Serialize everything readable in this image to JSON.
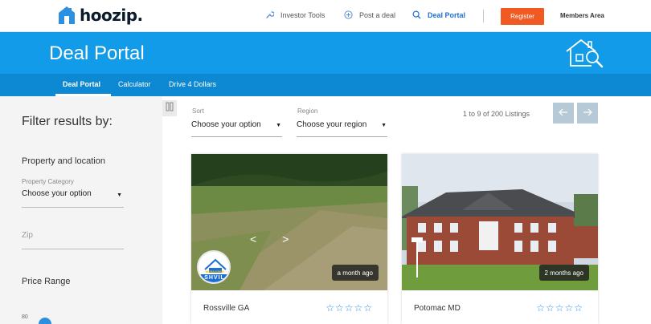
{
  "brand": {
    "logo_text": "hoozip."
  },
  "nav": {
    "investor_tools": "Investor Tools",
    "post_deal": "Post a deal",
    "deal_portal": "Deal Portal",
    "register": "Register",
    "members_area": "Members Area"
  },
  "hero": {
    "title": "Deal Portal"
  },
  "subnav": {
    "tabs": [
      "Deal Portal",
      "Calculator",
      "Drive 4 Dollars"
    ]
  },
  "sidebar": {
    "title": "Filter results by:",
    "property_location": "Property and location",
    "property_category_label": "Property Category",
    "property_category_value": "Choose your option",
    "zip_placeholder": "Zip",
    "price_range": "Price Range",
    "price_range_value": "80"
  },
  "filters": {
    "sort_label": "Sort",
    "sort_value": "Choose your option",
    "region_label": "Region",
    "region_value": "Choose your region",
    "listing_count": "1 to 9 of 200 Listings"
  },
  "cards": [
    {
      "city": "Rossville GA",
      "time": "a month ago",
      "badge_text": "SHVIL",
      "badge_small": "WEBUYERS",
      "stars": "☆☆☆☆☆"
    },
    {
      "city": "Potomac MD",
      "time": "2 months ago",
      "stars": "☆☆☆☆☆"
    }
  ],
  "colors": {
    "accent": "#119be8",
    "subnav": "#0d89d3",
    "register": "#f05a22",
    "active_link": "#1e6fd1"
  },
  "icons": {
    "logo": "house-logo-icon",
    "investor_tools": "wrench-icon",
    "post_deal": "plus-circle-icon",
    "deal_portal": "search-icon",
    "hero": "house-search-icon",
    "prev": "arrow-left-icon",
    "next": "arrow-right-icon",
    "collapse": "collapse-sidebar-icon"
  }
}
